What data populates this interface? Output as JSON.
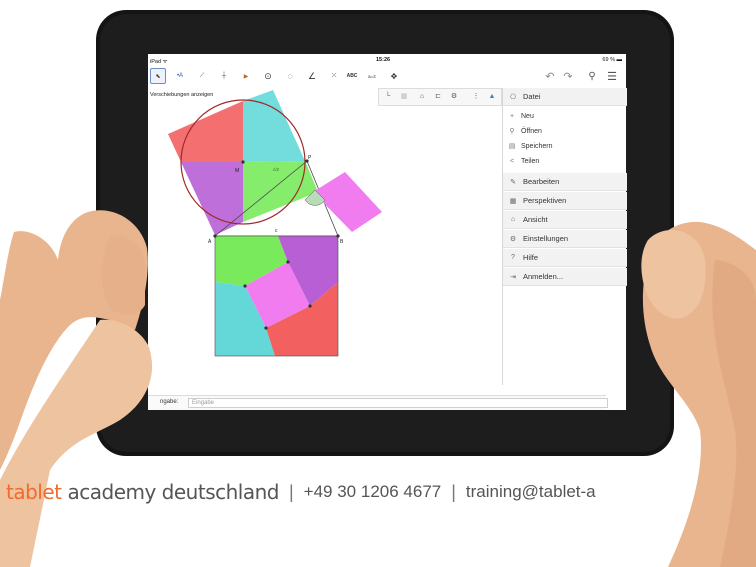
{
  "status_bar": {
    "device": "iPad ᯤ",
    "time": "15:26",
    "battery": "69 % ▬"
  },
  "toolbar": {
    "tools": [
      {
        "icon": "pointer-icon",
        "glyph": "⬉"
      },
      {
        "icon": "point-icon",
        "glyph": "•A"
      },
      {
        "icon": "line-icon",
        "glyph": "⟋"
      },
      {
        "icon": "perpendicular-icon",
        "glyph": "┼"
      },
      {
        "icon": "polygon-icon",
        "glyph": "▶"
      },
      {
        "icon": "circle-icon",
        "glyph": "⊙"
      },
      {
        "icon": "ellipse-icon",
        "glyph": "◌"
      },
      {
        "icon": "angle-icon",
        "glyph": "∠"
      },
      {
        "icon": "reflect-icon",
        "glyph": "⤫"
      },
      {
        "icon": "text-icon",
        "glyph": "ABC"
      },
      {
        "icon": "slider-icon",
        "glyph": "a=2"
      },
      {
        "icon": "move-view-icon",
        "glyph": "✥"
      }
    ],
    "undo": "↶",
    "redo": "↷",
    "search": "⚲",
    "menu": "☰"
  },
  "canvas": {
    "hint": "Verschiebungen anzeigen",
    "labels": {
      "M": "M",
      "P": "P",
      "A": "A",
      "B": "B",
      "c": "c",
      "half": "c/2"
    }
  },
  "style_bar": [
    "└",
    "▦",
    "⌂",
    "⊏",
    "⚙",
    "⋮",
    "▲"
  ],
  "menu": {
    "file": {
      "label": "Datei",
      "icon": "file-icon"
    },
    "file_items": [
      {
        "label": "Neu",
        "icon": "plus-icon",
        "glyph": "+"
      },
      {
        "label": "Öffnen",
        "icon": "search-icon",
        "glyph": "⚲"
      },
      {
        "label": "Speichern",
        "icon": "save-icon",
        "glyph": "▤"
      },
      {
        "label": "Teilen",
        "icon": "share-icon",
        "glyph": "<"
      }
    ],
    "sections": [
      {
        "label": "Bearbeiten",
        "icon": "edit-icon",
        "glyph": "✎"
      },
      {
        "label": "Perspektiven",
        "icon": "perspectives-icon",
        "glyph": "▦"
      },
      {
        "label": "Ansicht",
        "icon": "view-icon",
        "glyph": "⌂"
      },
      {
        "label": "Einstellungen",
        "icon": "settings-icon",
        "glyph": "⚙"
      },
      {
        "label": "Hilfe",
        "icon": "help-icon",
        "glyph": "?"
      },
      {
        "label": "Anmelden...",
        "icon": "signin-icon",
        "glyph": "⇥"
      }
    ]
  },
  "input_bar": {
    "label": "ngabe:",
    "placeholder": "Eingabe"
  },
  "footer": {
    "brand_a": "tablet",
    "brand_b": "academy deutschland",
    "separator": "|",
    "phone": "+49 30 1206 4677",
    "email": "training@tablet-a"
  },
  "colors": {
    "orange": "#f06b2c",
    "teal": "#64d8d8",
    "red": "#f36060",
    "purple": "#b85fd6",
    "green": "#78ea5c",
    "magenta": "#f07cf0"
  }
}
